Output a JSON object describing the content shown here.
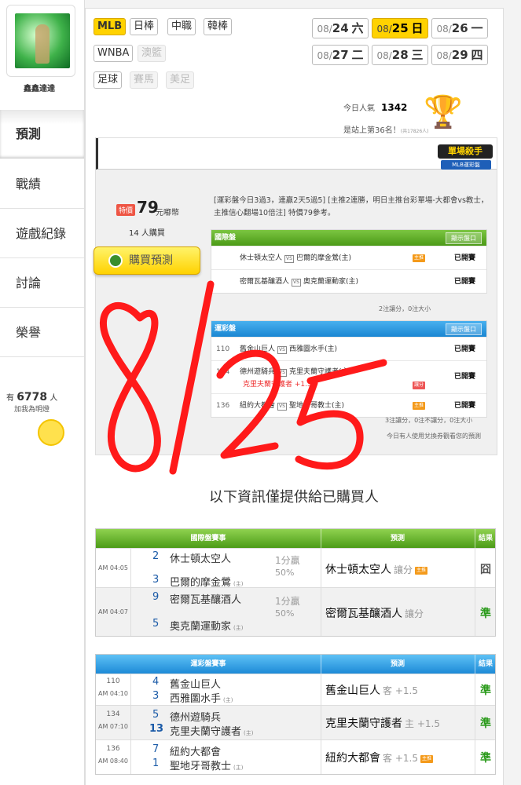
{
  "profile": {
    "username": "鑫鑫達達"
  },
  "sidebar": {
    "items": [
      {
        "label": "預測",
        "active": true
      },
      {
        "label": "戰績"
      },
      {
        "label": "遊戲紀錄"
      },
      {
        "label": "討論"
      },
      {
        "label": "榮譽"
      }
    ],
    "popularity_prefix": "有",
    "popularity_count": "6778",
    "popularity_suffix": "人",
    "popularity_sub": "加我為明燈"
  },
  "sports": {
    "row1": [
      "MLB",
      "日棒",
      "中職",
      "韓棒"
    ],
    "row2": [
      "WNBA",
      "澳籃"
    ],
    "row3": [
      "足球",
      "賽馬",
      "美足"
    ],
    "active": "MLB",
    "disabled": [
      "澳籃",
      "賽馬",
      "美足"
    ]
  },
  "dates": [
    {
      "prefix": "08/",
      "day": "24",
      "weekday": "六"
    },
    {
      "prefix": "08/",
      "day": "25",
      "weekday": "日",
      "active": true
    },
    {
      "prefix": "08/",
      "day": "26",
      "weekday": "一"
    },
    {
      "prefix": "08/",
      "day": "27",
      "weekday": "二"
    },
    {
      "prefix": "08/",
      "day": "28",
      "weekday": "三"
    },
    {
      "prefix": "08/",
      "day": "29",
      "weekday": "四"
    }
  ],
  "stats": {
    "popularity_label": "今日人氣",
    "popularity_value": "1342",
    "rank_text": "是站上第36名！",
    "rank_note": "(共17826人)"
  },
  "prediction": {
    "badge_main": "單場殺手",
    "badge_sub": "MLB運彩盤",
    "special_tag": "特價",
    "price": "79",
    "price_unit": "元嘟幣",
    "buyers": "14 人購買",
    "buy_button": "購買預測",
    "description": "[運彩盤今日3過3，連贏2天5過5] [主推2連勝，明日主推台彩單場-大都會vs教士，主推信心翻場10倍注] 特價79參考。",
    "intl_header": "國際盤",
    "show_odds": "顯示盤口",
    "intl_rows": [
      {
        "away": "休士頓太空人",
        "home": "巴爾的摩金鶯(主)",
        "tag": "主推",
        "status": "已開賽"
      },
      {
        "away": "密爾瓦基釀酒人",
        "home": "奧克蘭運動家(主)",
        "status": "已開賽"
      }
    ],
    "intl_note": "2注讓分，0注大小",
    "lottery_header": "運彩盤",
    "lottery_rows": [
      {
        "num": "110",
        "away": "舊金山巨人",
        "home": "西雅圖水手(主)",
        "status": "已開賽"
      },
      {
        "num": "134",
        "away": "德州遊騎兵",
        "home": "克里夫蘭守護者(主)",
        "pick": "克里夫蘭守護者 +1.5",
        "tag": "讓分",
        "status": "已開賽"
      },
      {
        "num": "136",
        "away": "紐約大都會",
        "home": "聖地牙哥教士(主)",
        "tag": "主推",
        "status": "已開賽"
      }
    ],
    "lottery_note": "3注讓分，0注不讓分，0注大小",
    "footer_note": "今日有人使用兌換券觀看您的預測"
  },
  "annotation": "8/25",
  "info_title": "以下資訊僅提供給已購買人",
  "intl_table": {
    "header_match": "國際盤賽事",
    "header_pick": "預測",
    "header_result": "結果",
    "rows": [
      {
        "time": "AM 04:05",
        "away_num": "2",
        "away": "休士頓太空人",
        "home_num": "3",
        "home": "巴爾的摩金鶯",
        "home_tag": "(主)",
        "line_top": "1分贏",
        "line_bottom": "50%",
        "pick": "休士頓太空人",
        "pick_sub": "讓分",
        "pick_tag": "主推",
        "result": "囧",
        "result_fail": true
      },
      {
        "time": "AM 04:07",
        "away_num": "9",
        "away": "密爾瓦基釀酒人",
        "home_num": "5",
        "home": "奧克蘭運動家",
        "home_tag": "(主)",
        "line_top": "1分贏",
        "line_bottom": "50%",
        "pick": "密爾瓦基釀酒人",
        "pick_sub": "讓分",
        "result": "準"
      }
    ]
  },
  "lottery_table": {
    "header_match": "運彩盤賽事",
    "header_pick": "預測",
    "header_result": "結果",
    "rows": [
      {
        "num": "110",
        "time": "AM 04:10",
        "away_score": "4",
        "away": "舊金山巨人",
        "home_score": "3",
        "home": "西雅圖水手",
        "home_tag": "(主)",
        "pick": "舊金山巨人",
        "pick_sub": "客 +1.5",
        "result": "準"
      },
      {
        "num": "134",
        "time": "AM 07:10",
        "away_score": "5",
        "away": "德州遊騎兵",
        "home_score": "13",
        "home": "克里夫蘭守護者",
        "home_tag": "(主)",
        "pick": "克里夫蘭守護者",
        "pick_sub": "主 +1.5",
        "result": "準"
      },
      {
        "num": "136",
        "time": "AM 08:40",
        "away_score": "7",
        "away": "紐約大都會",
        "home_score": "1",
        "home": "聖地牙哥教士",
        "home_tag": "(主)",
        "pick": "紐約大都會",
        "pick_sub": "客 +1.5",
        "pick_tag": "主推",
        "result": "準"
      }
    ]
  },
  "colors": {
    "accent_yellow": "#ffd200",
    "green": "#4c9b18",
    "blue": "#1d8ad7",
    "annotation_red": "#ff1a1a"
  }
}
